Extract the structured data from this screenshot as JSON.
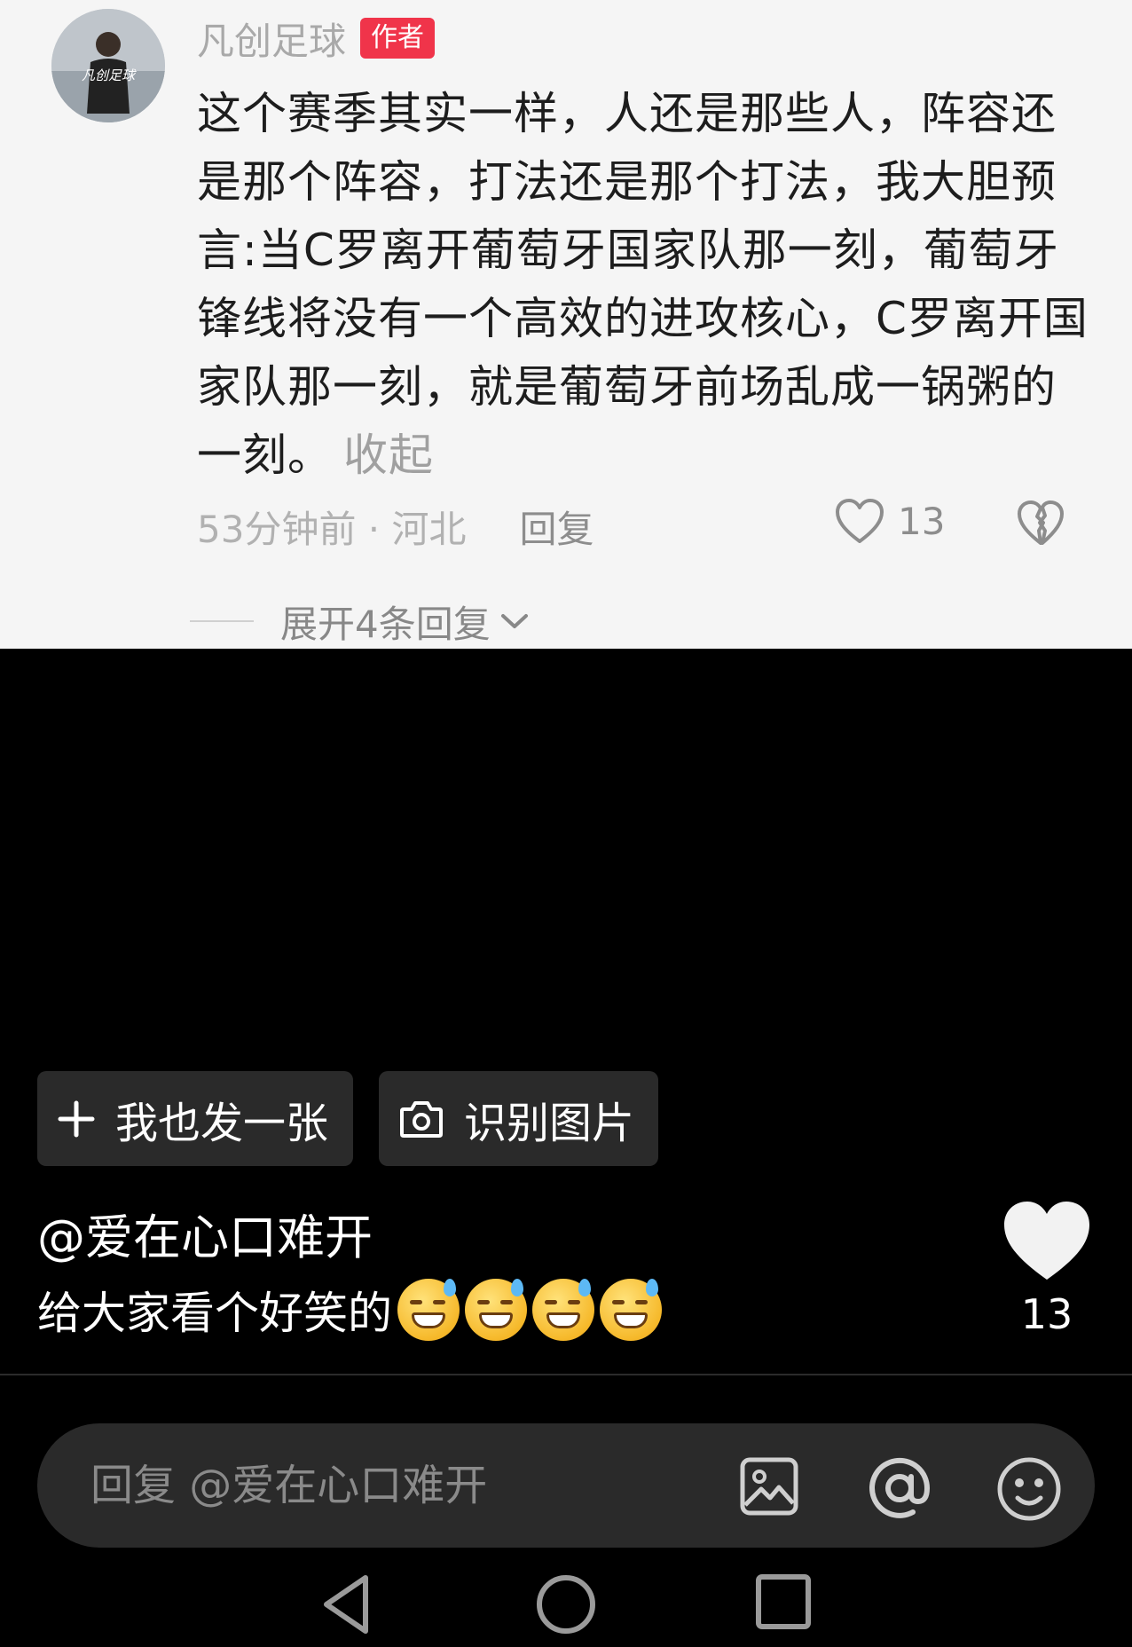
{
  "comment": {
    "author": "凡创足球",
    "author_tag": "作者",
    "avatar_text": "凡创足球",
    "text": "这个赛季其实一样，人还是那些人，阵容还是那个阵容，打法还是那个打法，我大胆预言:当C罗离开葡萄牙国家队那一刻，葡萄牙锋线将没有一个高效的进攻核心，C罗离开国家队那一刻，就是葡萄牙前场乱成一锅粥的一刻。",
    "collapse_label": "收起",
    "time_location": "53分钟前 · 河北",
    "reply_label": "回复",
    "like_count": "13",
    "expand_label": "展开4条回复"
  },
  "actions": {
    "post_label": "我也发一张",
    "ocr_label": "识别图片"
  },
  "reply": {
    "mention": "@爱在心口难开",
    "caption": "给大家看个好笑的",
    "emoji_count": 4,
    "like_count": "13"
  },
  "reply_bar": {
    "placeholder": "回复 @爱在心口难开"
  },
  "icons": [
    "heart-icon",
    "broken-heart-icon",
    "chevron-down-icon",
    "plus-icon",
    "camera-icon",
    "image-icon",
    "at-icon",
    "smiley-icon",
    "back-icon",
    "home-icon",
    "recents-icon"
  ]
}
